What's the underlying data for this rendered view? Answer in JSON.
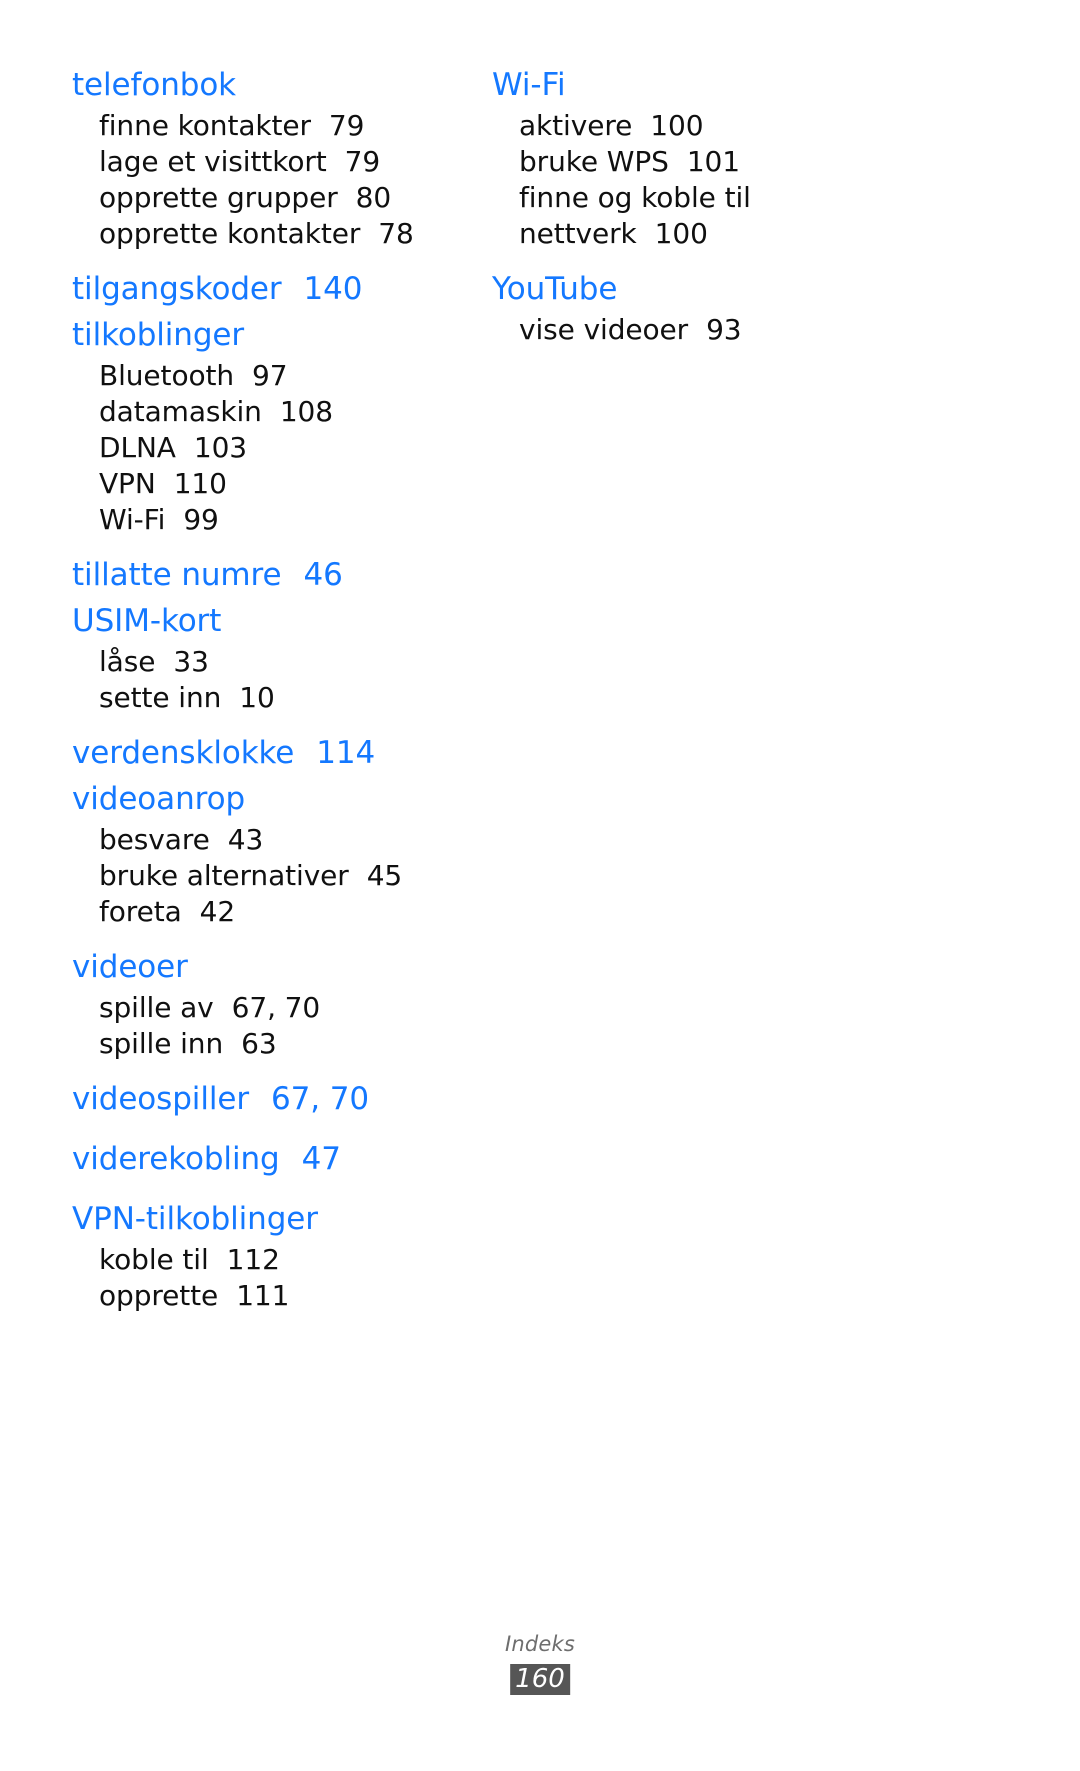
{
  "document": {
    "language": "Norwegian",
    "heading_color": "#1478ff",
    "body_color": "#101010",
    "background_color": "#ffffff"
  },
  "footer": {
    "section_label": "Indeks",
    "page_number": "160",
    "badge_color": "#565656",
    "badge_text_color": "#ffffff"
  },
  "columns": {
    "left": [
      {
        "heading": "telefonbok",
        "heading_page": "",
        "subentries": [
          {
            "label": "finne kontakter",
            "page": "79"
          },
          {
            "label": "lage et visittkort",
            "page": "79"
          },
          {
            "label": "opprette grupper",
            "page": "80"
          },
          {
            "label": "opprette kontakter",
            "page": "78"
          }
        ]
      },
      {
        "heading": "tilgangskoder",
        "heading_page": "140",
        "subentries": []
      },
      {
        "heading": "tilkoblinger",
        "heading_page": "",
        "subentries": [
          {
            "label": "Bluetooth",
            "page": "97"
          },
          {
            "label": "datamaskin",
            "page": "108"
          },
          {
            "label": "DLNA",
            "page": "103"
          },
          {
            "label": "VPN",
            "page": "110"
          },
          {
            "label": "Wi-Fi",
            "page": "99"
          }
        ]
      },
      {
        "heading": "tillatte numre",
        "heading_page": "46",
        "subentries": []
      },
      {
        "heading": "USIM-kort",
        "heading_page": "",
        "subentries": [
          {
            "label": "låse",
            "page": "33"
          },
          {
            "label": "sette inn",
            "page": "10"
          }
        ]
      },
      {
        "heading": "verdensklokke",
        "heading_page": "114",
        "subentries": []
      },
      {
        "heading": "videoanrop",
        "heading_page": "",
        "subentries": [
          {
            "label": "besvare",
            "page": "43"
          },
          {
            "label": "bruke alternativer",
            "page": "45"
          },
          {
            "label": "foreta",
            "page": "42"
          }
        ]
      },
      {
        "heading": "videoer",
        "heading_page": "",
        "subentries": [
          {
            "label": "spille av",
            "page": "67, 70"
          },
          {
            "label": "spille inn",
            "page": "63"
          }
        ]
      },
      {
        "heading": "videospiller",
        "heading_page": "67, 70",
        "subentries": []
      },
      {
        "heading": "viderekobling",
        "heading_page": "47",
        "subentries": []
      },
      {
        "heading": "VPN-tilkoblinger",
        "heading_page": "",
        "subentries": [
          {
            "label": "koble til",
            "page": "112"
          },
          {
            "label": "opprette",
            "page": "111"
          }
        ]
      }
    ],
    "right": [
      {
        "heading": "Wi-Fi",
        "heading_page": "",
        "subentries": [
          {
            "label": "aktivere",
            "page": "100"
          },
          {
            "label": "bruke WPS",
            "page": "101"
          },
          {
            "label": "finne og koble til nettverk",
            "page": "100"
          }
        ]
      },
      {
        "heading": "YouTube",
        "heading_page": "",
        "subentries": [
          {
            "label": "vise videoer",
            "page": "93"
          }
        ]
      }
    ]
  }
}
